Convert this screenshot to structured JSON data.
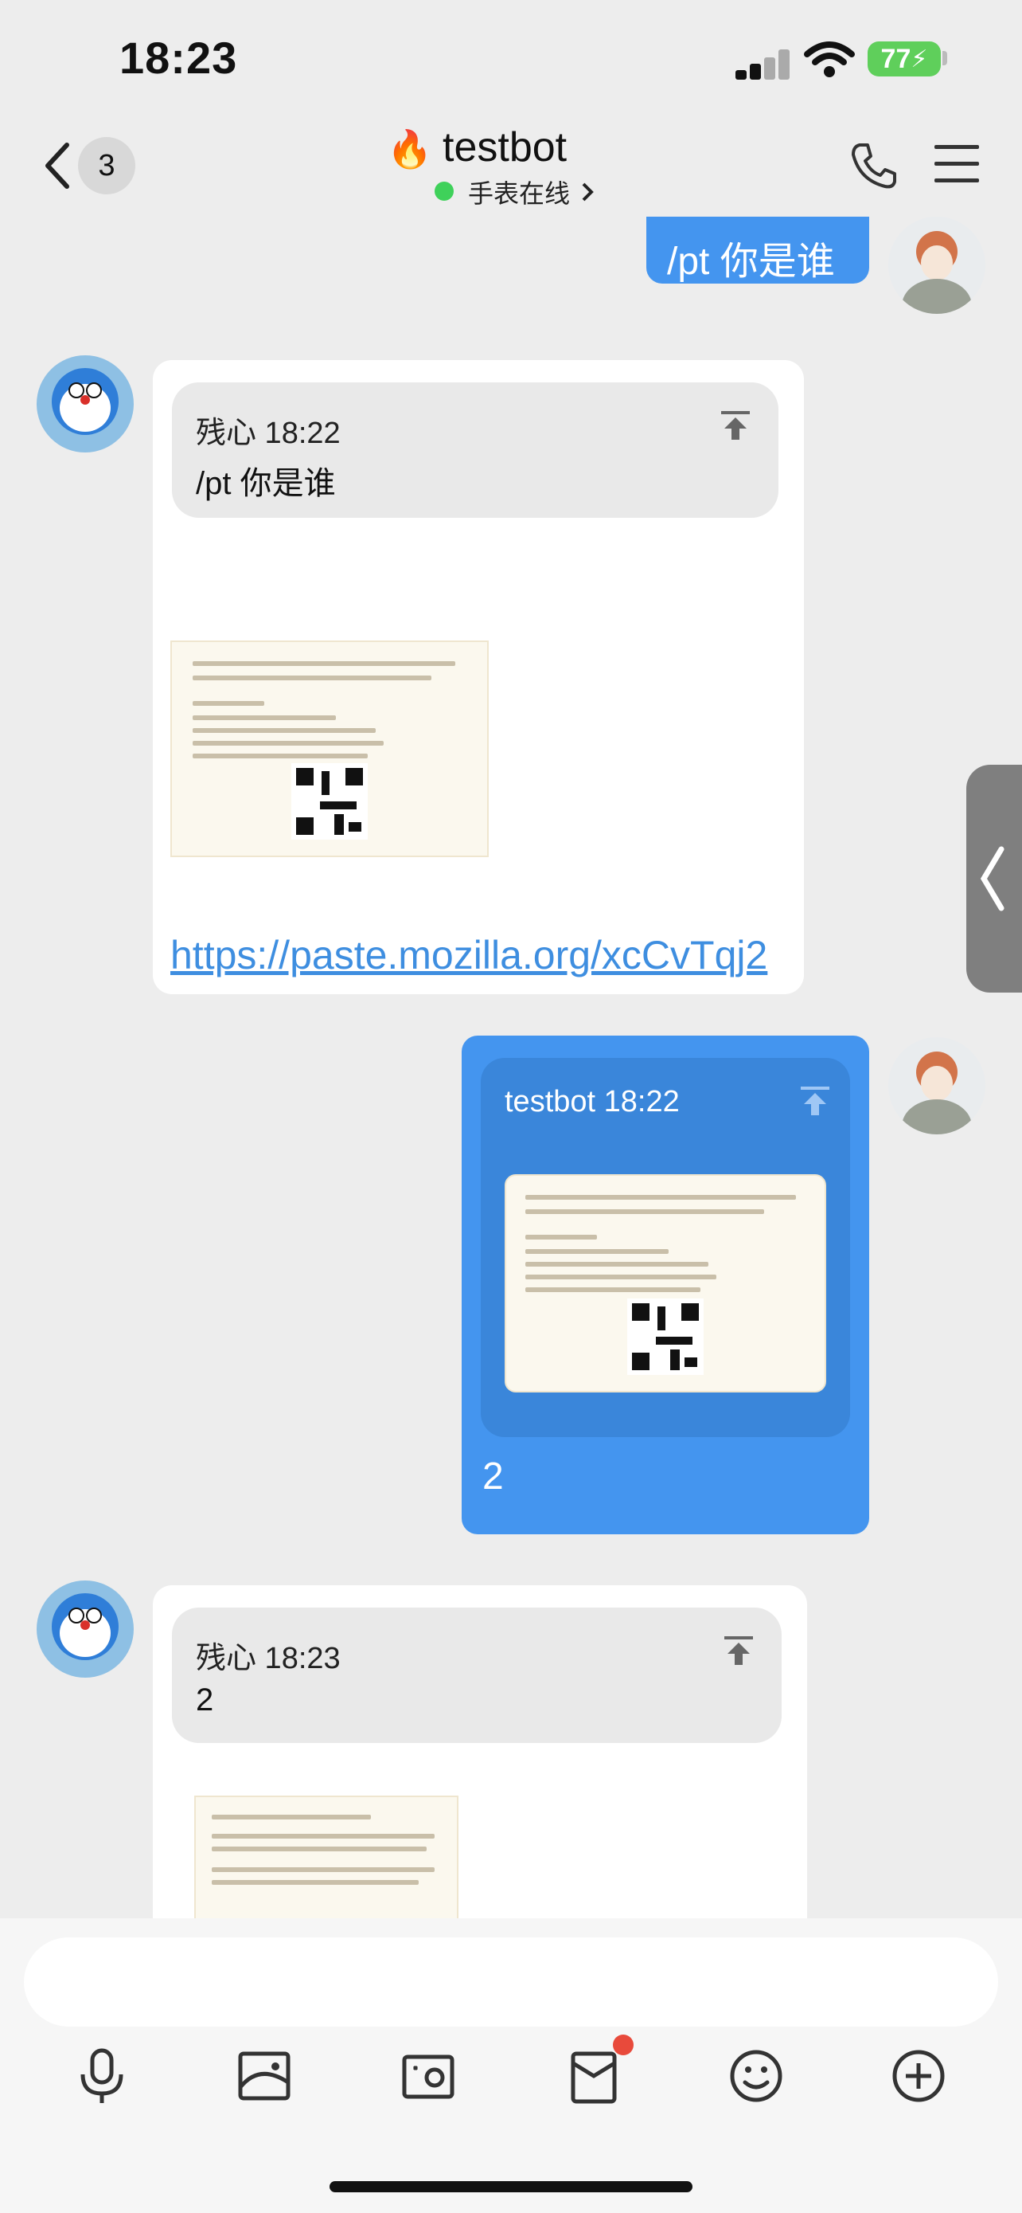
{
  "status_bar": {
    "time": "18:23",
    "battery": "77"
  },
  "nav": {
    "back_count": "3",
    "title_emoji": "🔥",
    "title": "testbot",
    "status": "手表在线"
  },
  "messages": {
    "m1": {
      "text": "/pt 你是谁"
    },
    "m2": {
      "quote_name": "残心 18:22",
      "quote_text": "/pt 你是谁",
      "link": "https://paste.mozilla.org/xcCvTqj2"
    },
    "m3": {
      "quote_name": "testbot 18:22",
      "text": "2"
    },
    "m4": {
      "quote_name": "残心 18:23",
      "quote_text": "2"
    }
  },
  "icons": [
    "back-icon",
    "phone-icon",
    "menu-icon",
    "pin-icon",
    "microphone-icon",
    "image-icon",
    "camera-icon",
    "red-packet-icon",
    "emoji-icon",
    "plus-icon",
    "collapse-icon"
  ],
  "colors": {
    "accent_blue": "#4495ef",
    "online_green": "#3fd15a",
    "link_blue": "#3e8ee0",
    "badge_red": "#e84a3b"
  }
}
